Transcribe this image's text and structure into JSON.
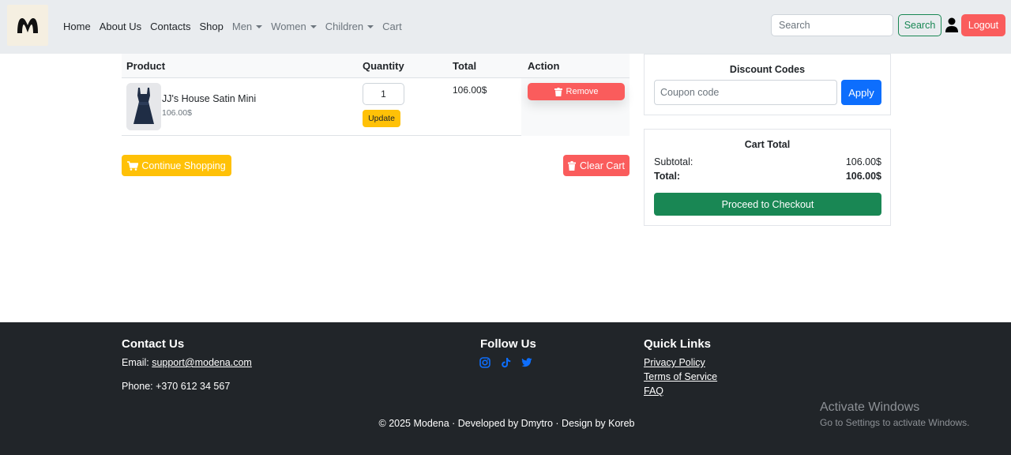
{
  "navbar": {
    "logo_alt": "Modena logo",
    "links": [
      {
        "label": "Home"
      },
      {
        "label": "About Us"
      },
      {
        "label": "Contacts"
      },
      {
        "label": "Shop"
      },
      {
        "label": "Men"
      },
      {
        "label": "Women"
      },
      {
        "label": "Children"
      },
      {
        "label": "Cart"
      }
    ],
    "search_placeholder": "Search",
    "search_button": "Search",
    "logout_button": "Logout"
  },
  "cart": {
    "headers": {
      "product": "Product",
      "quantity": "Quantity",
      "total": "Total",
      "action": "Action"
    },
    "items": [
      {
        "name": "JJ's House Satin Mini",
        "price": "106.00$",
        "quantity": "1",
        "update_label": "Update",
        "total": "106.00$",
        "remove_label": "Remove"
      }
    ],
    "continue_label": "Continue Shopping",
    "clear_label": "Clear Cart"
  },
  "discount": {
    "title": "Discount Codes",
    "placeholder": "Coupon code",
    "apply_label": "Apply"
  },
  "cart_total": {
    "title": "Cart Total",
    "subtotal_label": "Subtotal:",
    "subtotal_value": "106.00$",
    "total_label": "Total:",
    "total_value": "106.00$",
    "checkout_label": "Proceed to Checkout"
  },
  "footer": {
    "contact_heading": "Contact Us",
    "email_label": "Email: ",
    "email": "support@modena.com",
    "phone": "Phone: +370 612 34 567",
    "follow_heading": "Follow Us",
    "social_icons": [
      "instagram-icon",
      "tiktok-icon",
      "twitter-icon"
    ],
    "links_heading": "Quick Links",
    "links": [
      "Privacy Policy",
      "Terms of Service",
      "FAQ"
    ],
    "copyright": "© 2025 Modena · Developed by Dmytro · Design by Koreb"
  },
  "watermark": {
    "line1": "Activate Windows",
    "line2": "Go to Settings to activate Windows."
  },
  "colors": {
    "navbar_bg": "#e9ecef",
    "danger": "#fa5c5c",
    "warning": "#ffc107",
    "success": "#198754",
    "primary": "#0d6efd",
    "footer_bg": "#212529",
    "social_icon": "#0d6efd"
  }
}
